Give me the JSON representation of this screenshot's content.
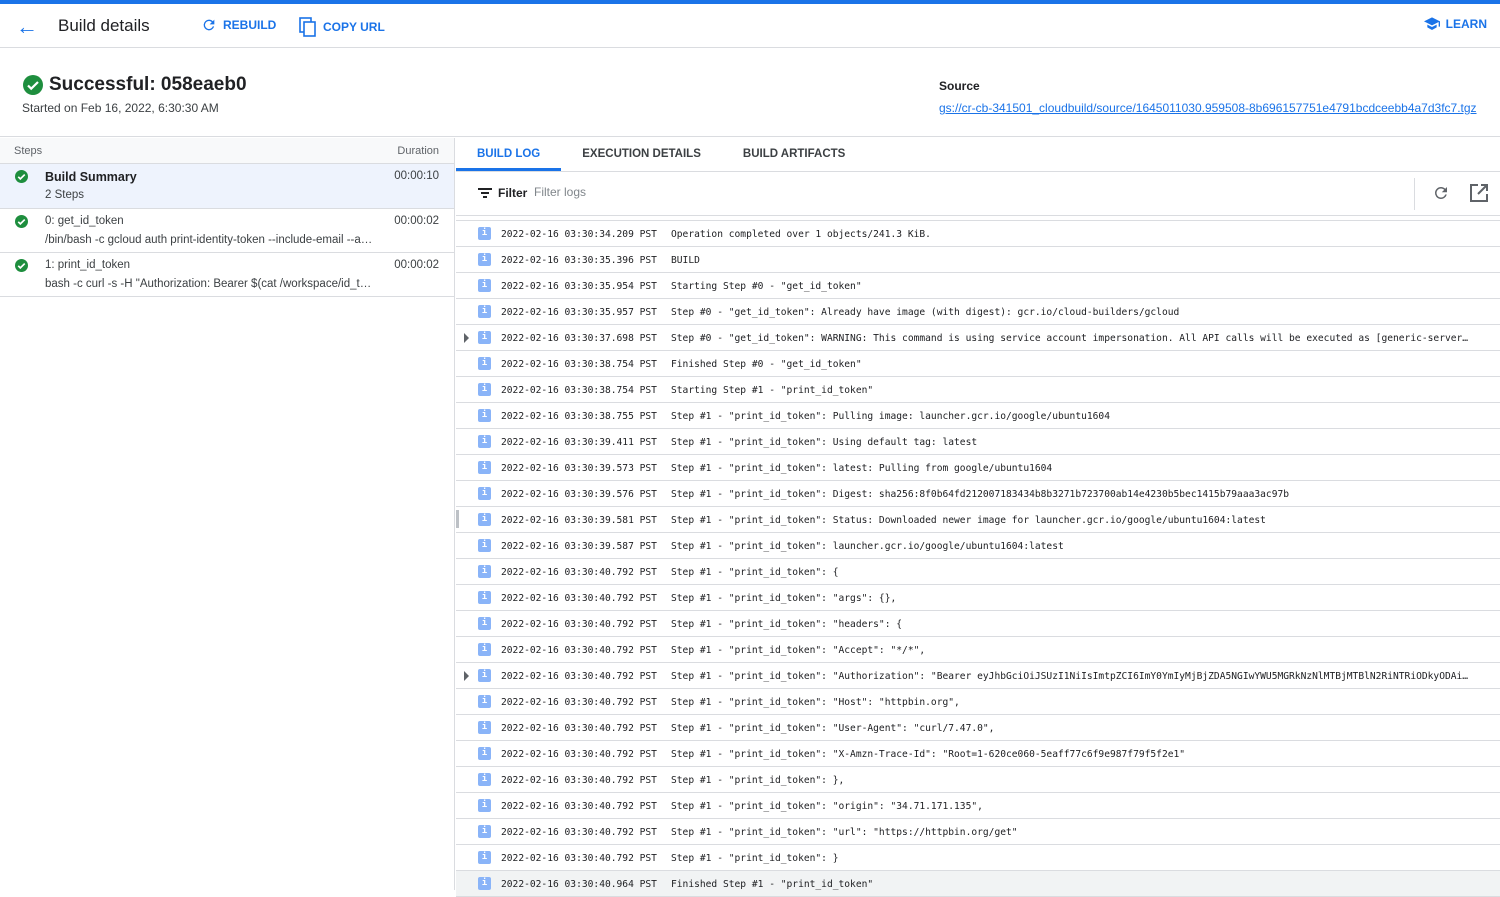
{
  "header": {
    "title": "Build details",
    "rebuild": "REBUILD",
    "copy_url": "COPY URL",
    "learn": "LEARN"
  },
  "summary": {
    "status": "Successful: 058eaeb0",
    "started": "Started on Feb 16, 2022, 6:30:30 AM",
    "source_label": "Source",
    "source_link": "gs://cr-cb-341501_cloudbuild/source/1645011030.959508-8b696157751e4791bcdceebb4a7d3fc7.tgz"
  },
  "steps": {
    "col_steps": "Steps",
    "col_duration": "Duration",
    "items": [
      {
        "name": "Build Summary",
        "sub": "2 Steps",
        "duration": "00:00:10",
        "status": "success"
      },
      {
        "name": "0: get_id_token",
        "sub": "/bin/bash -c gcloud auth print-identity-token --include-email --a…",
        "duration": "00:00:02",
        "status": "success"
      },
      {
        "name": "1: print_id_token",
        "sub": "bash -c curl -s -H \"Authorization: Bearer $(cat /workspace/id_t…",
        "duration": "00:00:02",
        "status": "success"
      }
    ]
  },
  "tabs": [
    "BUILD LOG",
    "EXECUTION DETAILS",
    "BUILD ARTIFACTS"
  ],
  "filter": {
    "label": "Filter",
    "placeholder": "Filter logs"
  },
  "logs": [
    {
      "t": "2022-02-16 03:30:34.209 PST",
      "m": "Operation completed over 1 objects/241.3 KiB."
    },
    {
      "t": "2022-02-16 03:30:35.396 PST",
      "m": "BUILD"
    },
    {
      "t": "2022-02-16 03:30:35.954 PST",
      "m": "Starting Step #0 - \"get_id_token\""
    },
    {
      "t": "2022-02-16 03:30:35.957 PST",
      "m": "Step #0 - \"get_id_token\": Already have image (with digest): gcr.io/cloud-builders/gcloud"
    },
    {
      "t": "2022-02-16 03:30:37.698 PST",
      "m": "Step #0 - \"get_id_token\": WARNING: This command is using service account impersonation. All API calls will be executed as [generic-server…",
      "expandable": true
    },
    {
      "t": "2022-02-16 03:30:38.754 PST",
      "m": "Finished Step #0 - \"get_id_token\""
    },
    {
      "t": "2022-02-16 03:30:38.754 PST",
      "m": "Starting Step #1 - \"print_id_token\""
    },
    {
      "t": "2022-02-16 03:30:38.755 PST",
      "m": "Step #1 - \"print_id_token\": Pulling image: launcher.gcr.io/google/ubuntu1604"
    },
    {
      "t": "2022-02-16 03:30:39.411 PST",
      "m": "Step #1 - \"print_id_token\": Using default tag: latest"
    },
    {
      "t": "2022-02-16 03:30:39.573 PST",
      "m": "Step #1 - \"print_id_token\": latest: Pulling from google/ubuntu1604"
    },
    {
      "t": "2022-02-16 03:30:39.576 PST",
      "m": "Step #1 - \"print_id_token\": Digest: sha256:8f0b64fd212007183434b8b3271b723700ab14e4230b5bec1415b79aaa3ac97b"
    },
    {
      "t": "2022-02-16 03:30:39.581 PST",
      "m": "Step #1 - \"print_id_token\": Status: Downloaded newer image for launcher.gcr.io/google/ubuntu1604:latest"
    },
    {
      "t": "2022-02-16 03:30:39.587 PST",
      "m": "Step #1 - \"print_id_token\": launcher.gcr.io/google/ubuntu1604:latest"
    },
    {
      "t": "2022-02-16 03:30:40.792 PST",
      "m": "Step #1 - \"print_id_token\": {"
    },
    {
      "t": "2022-02-16 03:30:40.792 PST",
      "m": "Step #1 - \"print_id_token\": \"args\": {},"
    },
    {
      "t": "2022-02-16 03:30:40.792 PST",
      "m": "Step #1 - \"print_id_token\": \"headers\": {"
    },
    {
      "t": "2022-02-16 03:30:40.792 PST",
      "m": "Step #1 - \"print_id_token\": \"Accept\": \"*/*\","
    },
    {
      "t": "2022-02-16 03:30:40.792 PST",
      "m": "Step #1 - \"print_id_token\": \"Authorization\": \"Bearer eyJhbGciOiJSUzI1NiIsImtpZCI6ImY0YmIyMjBjZDA5NGIwYWU5MGRkNzNlMTBjMTBlN2RiNTRiODkyODAi…",
      "expandable": true
    },
    {
      "t": "2022-02-16 03:30:40.792 PST",
      "m": "Step #1 - \"print_id_token\": \"Host\": \"httpbin.org\","
    },
    {
      "t": "2022-02-16 03:30:40.792 PST",
      "m": "Step #1 - \"print_id_token\": \"User-Agent\": \"curl/7.47.0\","
    },
    {
      "t": "2022-02-16 03:30:40.792 PST",
      "m": "Step #1 - \"print_id_token\": \"X-Amzn-Trace-Id\": \"Root=1-620ce060-5eaff77c6f9e987f79f5f2e1\""
    },
    {
      "t": "2022-02-16 03:30:40.792 PST",
      "m": "Step #1 - \"print_id_token\": },"
    },
    {
      "t": "2022-02-16 03:30:40.792 PST",
      "m": "Step #1 - \"print_id_token\": \"origin\": \"34.71.171.135\","
    },
    {
      "t": "2022-02-16 03:30:40.792 PST",
      "m": "Step #1 - \"print_id_token\": \"url\": \"https://httpbin.org/get\""
    },
    {
      "t": "2022-02-16 03:30:40.792 PST",
      "m": "Step #1 - \"print_id_token\": }"
    },
    {
      "t": "2022-02-16 03:30:40.964 PST",
      "m": "Finished Step #1 - \"print_id_token\"",
      "highlight": true
    }
  ],
  "colors": {
    "accent": "#1a73e8",
    "success": "#1e8e3e",
    "info": "#8ab4f8"
  },
  "icons": {
    "info": "i"
  }
}
